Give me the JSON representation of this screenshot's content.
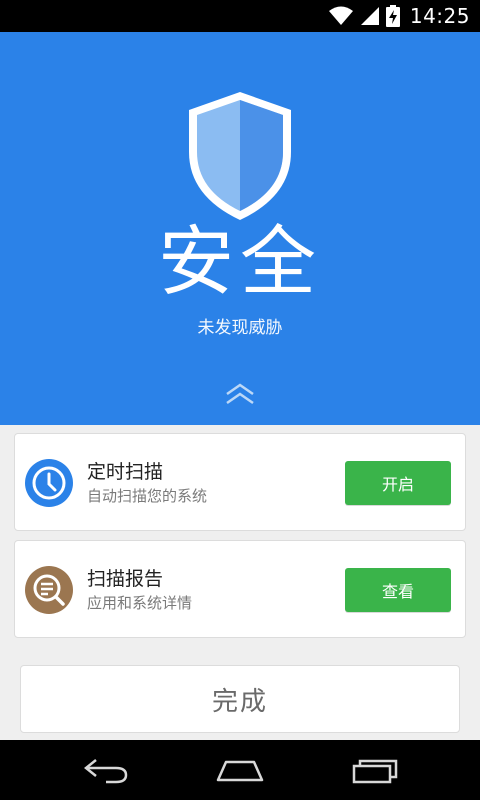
{
  "status_bar": {
    "time": "14:25",
    "icons": [
      "wifi-icon",
      "signal-icon",
      "battery-charging-icon"
    ]
  },
  "hero": {
    "title": "安全",
    "subtitle": "未发现威胁",
    "background_color": "#2b82e8",
    "icon": "shield-icon",
    "expand_icon": "double-chevron-up-icon"
  },
  "cards": [
    {
      "title": "定时扫描",
      "subtitle": "自动扫描您的系统",
      "button_label": "开启",
      "icon": "clock-icon",
      "icon_color": "#2b82e8"
    },
    {
      "title": "扫描报告",
      "subtitle": "应用和系统详情",
      "button_label": "查看",
      "icon": "report-search-icon",
      "icon_color": "#9b7650"
    }
  ],
  "button_color": "#3ab44a",
  "done_button": {
    "label": "完成"
  },
  "nav_bar": {
    "buttons": [
      "back-icon",
      "home-icon",
      "recent-apps-icon"
    ]
  }
}
